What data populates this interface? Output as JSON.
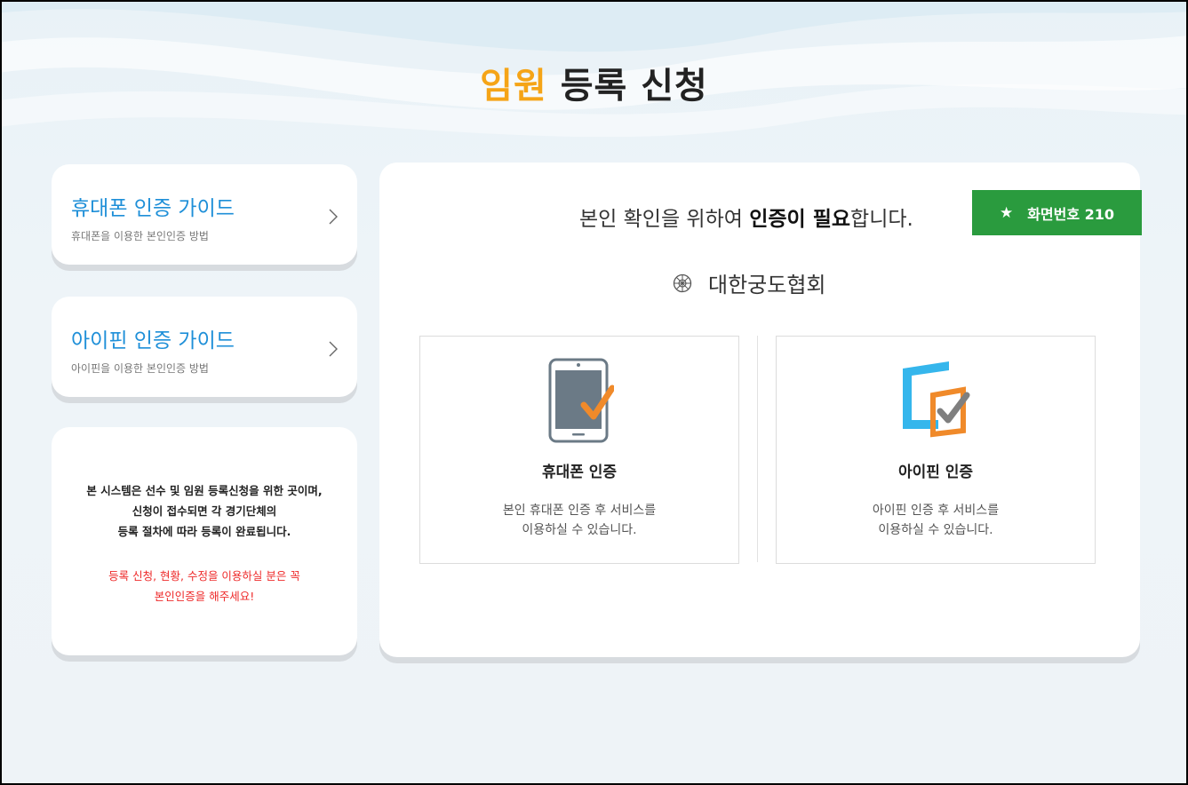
{
  "header": {
    "title_accent": "임원",
    "title_rest": "등록 신청"
  },
  "guides": [
    {
      "title": "휴대폰 인증 가이드",
      "subtitle": "휴대폰을 이용한 본인인증 방법"
    },
    {
      "title": "아이핀 인증 가이드",
      "subtitle": "아이핀을 이용한 본인인증 방법"
    }
  ],
  "info": {
    "lines": [
      "본 시스템은 선수 및 임원 등록신청을 위한 곳이며,",
      "신청이 접수되면 각 경기단체의",
      "등록 절차에 따라 등록이 완료됩니다."
    ],
    "warning_lines": [
      "등록 신청, 현황, 수정을 이용하실 분은 꼭",
      "본인인증을 해주세요!"
    ]
  },
  "main": {
    "notice_pre": "본인 확인을 위하여 ",
    "notice_bold": "인증이 필요",
    "notice_post": "합니다.",
    "badge_label": "화면번호 210",
    "badge_icon": "star-icon",
    "org_name": "대한궁도협회",
    "org_icon": "association-emblem-icon"
  },
  "methods": [
    {
      "title": "휴대폰 인증",
      "desc_lines": [
        "본인 휴대폰 인증 후 서비스를",
        "이용하실 수 있습니다."
      ],
      "icon": "phone-check-icon"
    },
    {
      "title": "아이핀 인증",
      "desc_lines": [
        "아이핀 인증 후 서비스를",
        "이용하실 수 있습니다."
      ],
      "icon": "ipin-check-icon"
    }
  ],
  "colors": {
    "accent": "#f5a417",
    "link_blue": "#1e8fd8",
    "badge_green": "#2a9b3e",
    "warning_red": "#ee2a2a"
  }
}
